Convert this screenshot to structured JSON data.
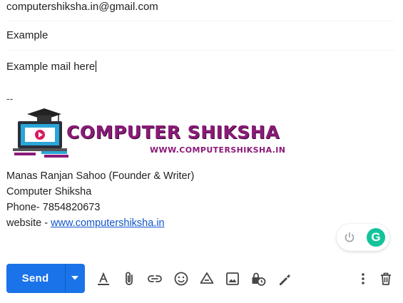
{
  "compose": {
    "to": "computershiksha.in@gmail.com",
    "subject": "Example",
    "body": "Example mail here"
  },
  "signature": {
    "separator": "--",
    "logo": {
      "title": "COMPUTER SHIKSHA",
      "url": "WWW.COMPUTERSHIKSHA.IN"
    },
    "name": "Manas Ranjan Sahoo (Founder & Writer)",
    "company": "Computer Shiksha",
    "phone": "Phone- 7854820673",
    "website_prefix": "website - ",
    "website_link": "www.computershiksha.in"
  },
  "grammarly": {
    "badge": "G",
    "icons": [
      "power-icon",
      "grammarly-icon"
    ]
  },
  "toolbar": {
    "send_label": "Send",
    "icons": [
      "formatting-options-icon",
      "attach-files-icon",
      "insert-link-icon",
      "insert-emoji-icon",
      "google-drive-icon",
      "insert-photo-icon",
      "confidential-mode-icon",
      "signature-icon",
      "more-options-icon",
      "discard-draft-icon"
    ]
  },
  "colors": {
    "send_button": "#1a73e8",
    "link": "#1155cc",
    "grammarly": "#15c39a",
    "logo_text": "#8a1a78",
    "icon": "#444746"
  }
}
